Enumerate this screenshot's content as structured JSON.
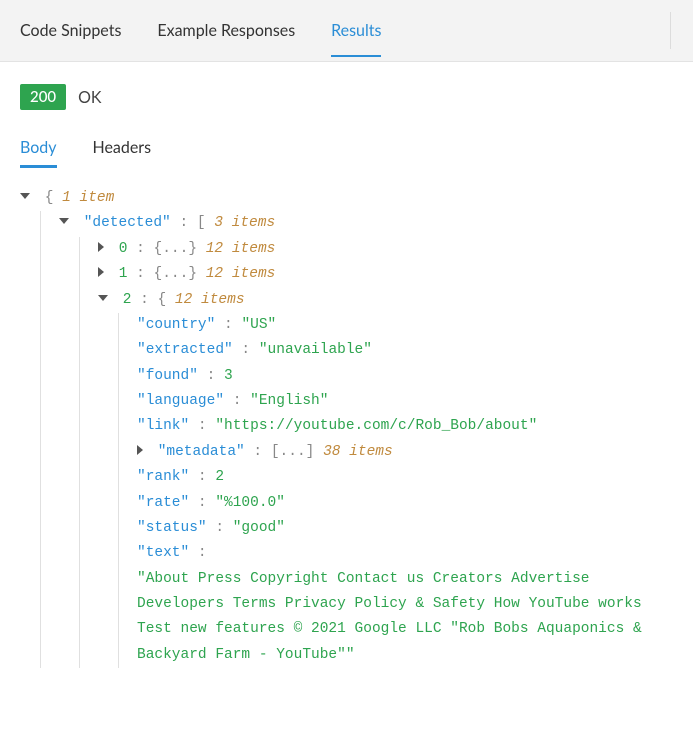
{
  "topTabs": {
    "snippets": "Code Snippets",
    "examples": "Example Responses",
    "results": "Results"
  },
  "status": {
    "code": "200",
    "text": "OK"
  },
  "subTabs": {
    "body": "Body",
    "headers": "Headers"
  },
  "json": {
    "rootCount": "1 item",
    "detectedKey": "detected",
    "detectedCount": "3 items",
    "items": [
      {
        "index": "0",
        "count": "12 items"
      },
      {
        "index": "1",
        "count": "12 items"
      }
    ],
    "expanded": {
      "index": "2",
      "count": "12 items",
      "fields": {
        "country": {
          "key": "country",
          "value": "\"US\""
        },
        "extracted": {
          "key": "extracted",
          "value": "\"unavailable\""
        },
        "found": {
          "key": "found",
          "value": "3"
        },
        "language": {
          "key": "language",
          "value": "\"English\""
        },
        "link": {
          "key": "link",
          "value": "\"https://youtube.com/c/Rob_Bob/about\""
        },
        "metadata": {
          "key": "metadata",
          "count": "38 items"
        },
        "rank": {
          "key": "rank",
          "value": "2"
        },
        "rate": {
          "key": "rate",
          "value": "\"%100.0\""
        },
        "status": {
          "key": "status",
          "value": "\"good\""
        },
        "text": {
          "key": "text",
          "value": "\"About Press Copyright Contact us Creators Advertise Developers Terms Privacy Policy & Safety How YouTube works Test new features © 2021 Google LLC \"Rob Bobs Aquaponics & Backyard Farm - YouTube\"\""
        }
      }
    }
  }
}
